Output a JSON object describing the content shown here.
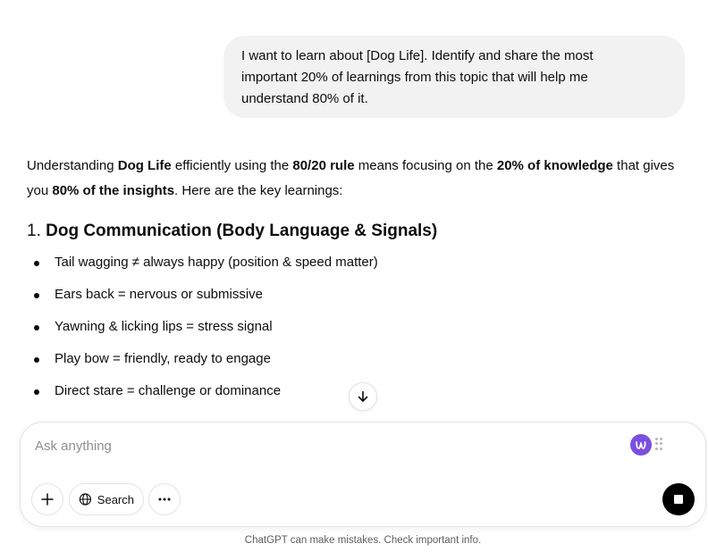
{
  "user_message": {
    "line1": "I want to learn about [Dog Life]. Identify and share the most",
    "line2": "important 20% of learnings from this topic that will help me",
    "line3": "understand 80% of it."
  },
  "assistant": {
    "intro": {
      "p1": "Understanding ",
      "b1": "Dog Life",
      "p2": " efficiently using the ",
      "b2": "80/20 rule",
      "p3": " means focusing on the ",
      "b3": "20% of knowledge",
      "p4": " that gives you ",
      "b4": "80% of the insights",
      "p5": ". Here are the key learnings:"
    },
    "section": {
      "number": "1. ",
      "title": "Dog Communication (Body Language & Signals)"
    },
    "bullets": [
      "Tail wagging ≠ always happy (position & speed matter)",
      "Ears back = nervous or submissive",
      "Yawning & licking lips = stress signal",
      "Play bow = friendly, ready to engage",
      "Direct stare = challenge or dominance"
    ]
  },
  "composer": {
    "placeholder": "Ask anything",
    "search_label": "Search"
  },
  "footer": {
    "disclaimer": "ChatGPT can make mistakes. Check important info."
  },
  "icons": {
    "scroll": "arrow-down-icon",
    "plus": "plus-icon",
    "search": "globe-icon",
    "more": "more-icon",
    "stop": "stop-icon",
    "extension": "extension-logo-icon"
  },
  "colors": {
    "user_bubble": "#f2f2f2",
    "extension_badge": "#7b4fe0",
    "stop_button": "#000000"
  }
}
